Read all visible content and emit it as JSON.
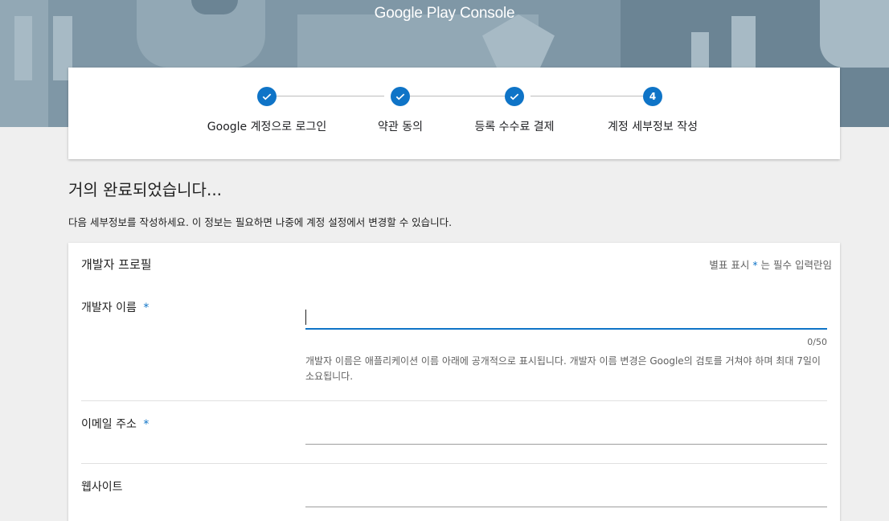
{
  "brand": {
    "title": "Google Play Console"
  },
  "stepper": {
    "steps": [
      {
        "label": "Google 계정으로 로그인",
        "state": "done"
      },
      {
        "label": "약관 동의",
        "state": "done"
      },
      {
        "label": "등록 수수료 결제",
        "state": "done"
      },
      {
        "label": "계정 세부정보 작성",
        "state": "current",
        "number": "4"
      }
    ]
  },
  "page": {
    "title": "거의 완료되었습니다...",
    "description": "다음 세부정보를 작성하세요. 이 정보는 필요하면 나중에 계정 설정에서 변경할 수 있습니다."
  },
  "form": {
    "section_title": "개발자 프로필",
    "required_note_prefix": "별표 표시",
    "required_note_suffix": "는 필수 입력란임",
    "required_star": "*",
    "fields": {
      "developer_name": {
        "label": "개발자 이름",
        "value": "",
        "counter": "0/50",
        "help": "개발자 이름은 애플리케이션 이름 아래에 공개적으로 표시됩니다. 개발자 이름 변경은 Google의 검토를 거쳐야 하며 최대 7일이 소요됩니다."
      },
      "email": {
        "label": "이메일 주소",
        "value": ""
      },
      "website": {
        "label": "웹사이트",
        "value": ""
      }
    }
  },
  "colors": {
    "accent": "#0f74c7",
    "banner": "#7f97a6",
    "background": "#efefef"
  }
}
